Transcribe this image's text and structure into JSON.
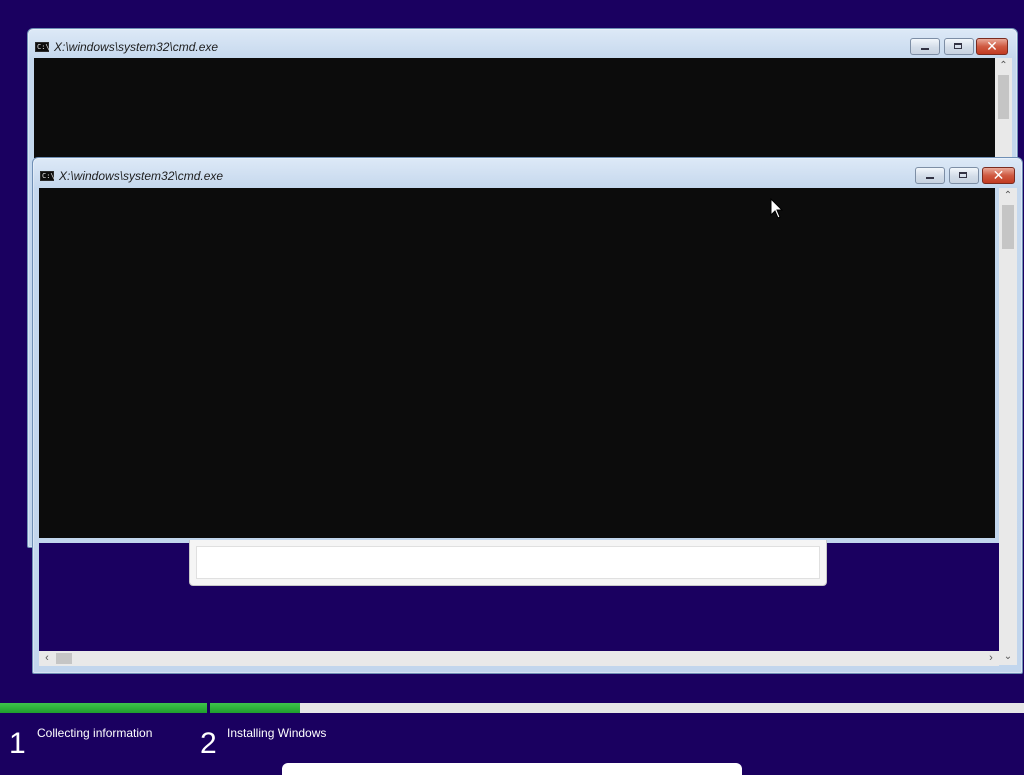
{
  "background_color": "#1a0060",
  "windows": [
    {
      "id": "back",
      "title": "X:\\windows\\system32\\cmd.exe",
      "icon": "cmd-icon",
      "icon_text": "C:\\",
      "console_bg": "#0c0c0c"
    },
    {
      "id": "front",
      "title": "X:\\windows\\system32\\cmd.exe",
      "icon": "cmd-icon",
      "icon_text": "C:\\",
      "console_bg": "#0c0c0c"
    }
  ],
  "setup": {
    "steps": [
      {
        "number": "1",
        "label": "Collecting information",
        "progress": 1.0
      },
      {
        "number": "2",
        "label": "Installing Windows",
        "progress": 0.11
      }
    ],
    "progress_color": "#2db33a"
  },
  "icons": {
    "minimize": "minimize-icon",
    "maximize": "maximize-icon",
    "close": "close-icon",
    "scroll_up": "chevron-up-icon",
    "scroll_down": "chevron-down-icon",
    "scroll_left": "chevron-left-icon",
    "scroll_right": "chevron-right-icon",
    "cursor": "mouse-pointer-icon"
  }
}
